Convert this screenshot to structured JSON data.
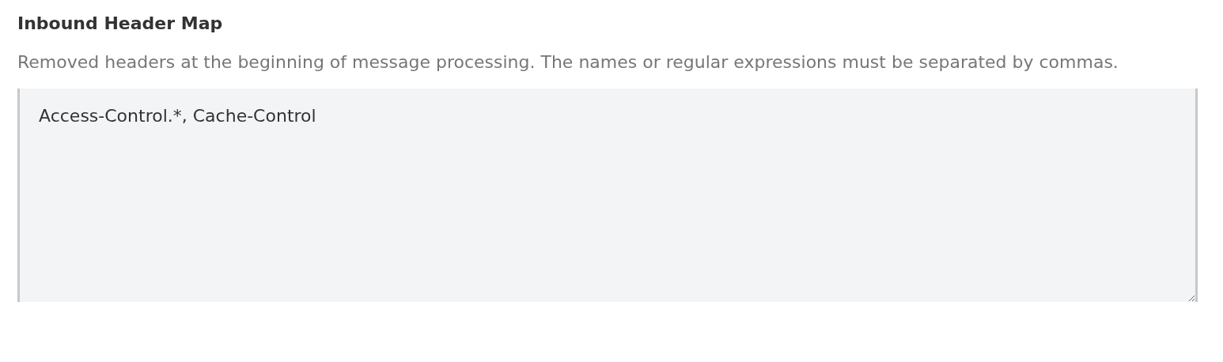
{
  "field": {
    "label": "Inbound Header Map",
    "description": "Removed headers at the beginning of message processing. The names or regular expressions must be separated by commas.",
    "value": "Access-Control.*, Cache-Control"
  }
}
